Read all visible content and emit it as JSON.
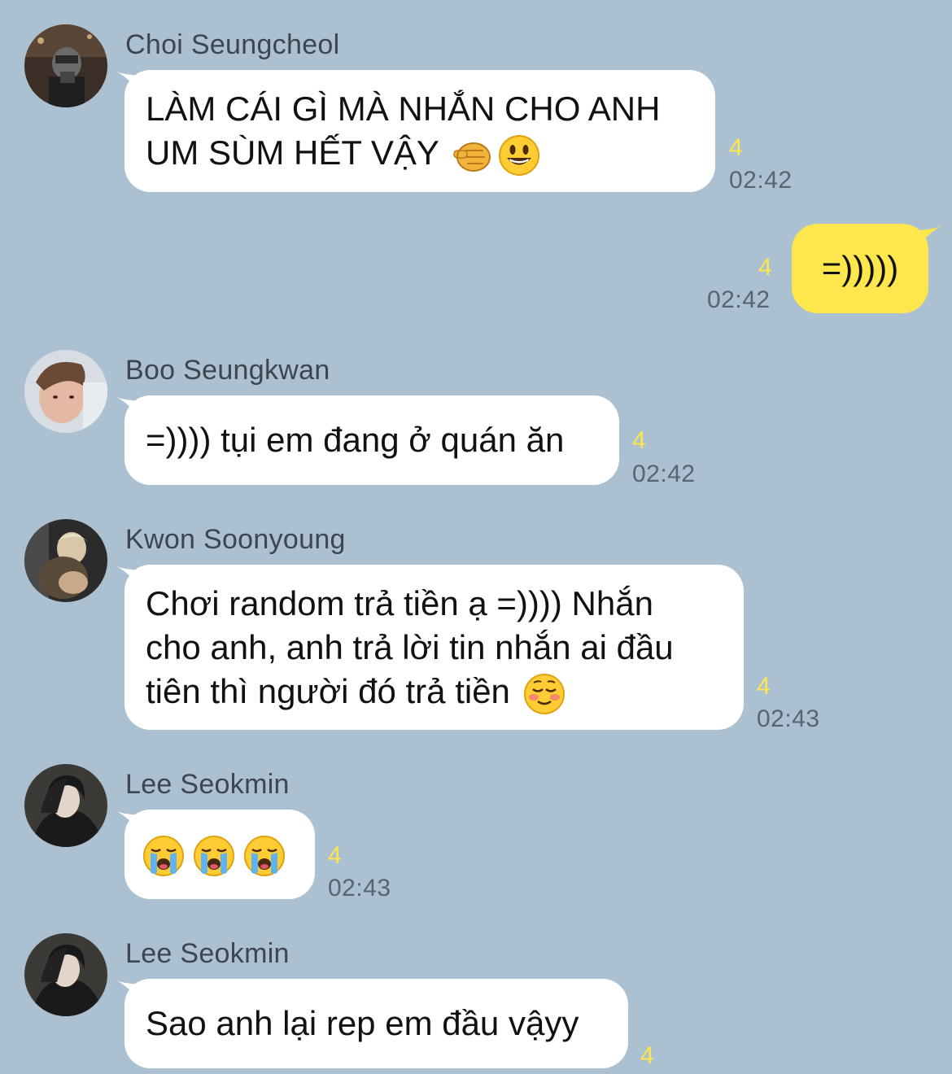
{
  "messages": [
    {
      "sender": "Choi Seungcheol",
      "lines": [
        "LÀM CÁI GÌ MÀ NHẮN CHO ANH",
        "UM SÙM HẾT VẬY"
      ],
      "emojis": [
        "pointing-fist-emoji",
        "grinning-face-emoji"
      ],
      "read_count": "4",
      "time": "02:42"
    },
    {
      "sender": "",
      "mine": true,
      "lines": [
        "=)))))"
      ],
      "read_count": "4",
      "time": "02:42"
    },
    {
      "sender": "Boo Seungkwan",
      "lines": [
        "=)))) tụi em đang ở quán ăn"
      ],
      "read_count": "4",
      "time": "02:42"
    },
    {
      "sender": "Kwon Soonyoung",
      "lines": [
        "Chơi random trả tiền ạ =)))) Nhắn",
        "cho anh, anh trả lời tin nhắn ai đầu",
        "tiên thì người đó trả tiền"
      ],
      "emojis": [
        "smiling-blush-face-emoji"
      ],
      "read_count": "4",
      "time": "02:43"
    },
    {
      "sender": "Lee Seokmin",
      "lines": [
        ""
      ],
      "emojis": [
        "loudly-crying-face-emoji",
        "loudly-crying-face-emoji",
        "loudly-crying-face-emoji"
      ],
      "read_count": "4",
      "time": "02:43"
    },
    {
      "sender": "Lee Seokmin",
      "lines": [
        "Sao anh lại rep em đầu vậyy"
      ],
      "read_count": "4",
      "time": ""
    }
  ],
  "colors": {
    "background": "#abc1d1",
    "incoming_bubble": "#ffffff",
    "outgoing_bubble": "#fde74c",
    "read_count": "#fde74c",
    "timestamp": "#556575",
    "sender_name": "#3d4650"
  }
}
